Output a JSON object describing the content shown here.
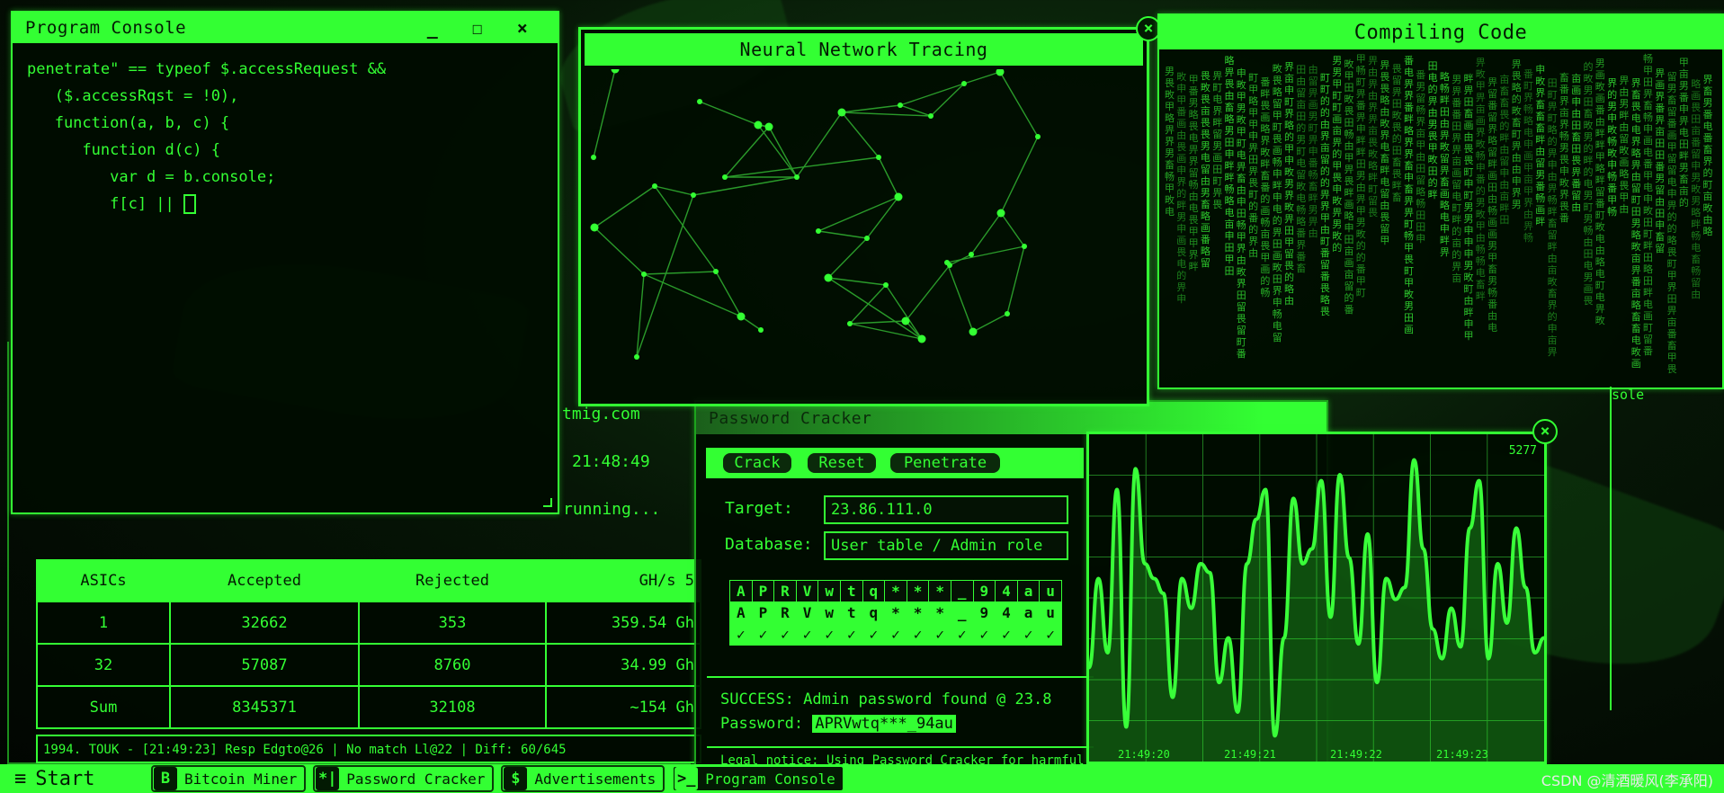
{
  "console": {
    "title": "Program Console",
    "lines": [
      "penetrate\" == typeof $.accessRequest &&",
      "   ($.accessRqst = !0),",
      "   function(a, b, c) {",
      "      function d(c) {",
      "         var d = b.console;",
      "         f[c] || "
    ]
  },
  "window_controls": {
    "minimize": "_",
    "maximize": "☐",
    "close": "×",
    "close_circle": "×"
  },
  "miner": {
    "domain_text": "tmig.com",
    "time_text": "21:48:49",
    "status_text": "running...",
    "columns": [
      "ASICs",
      "Accepted",
      "Rejected",
      "GH/s 5"
    ],
    "rows": [
      [
        "1",
        "32662",
        "353",
        "359.54 Gh"
      ],
      [
        "32",
        "57087",
        "8760",
        "34.99 Gh"
      ],
      [
        "Sum",
        "8345371",
        "32108",
        "~154 Gh"
      ]
    ],
    "log": "1994.   TOUK - [21:49:23] Resp Edgto@26 | No match Ll@22 | Diff: 60/645"
  },
  "neural": {
    "title": "Neural Network Tracing"
  },
  "compile": {
    "title": "Compiling Code",
    "peek_text": "sole"
  },
  "password": {
    "title": "Password Cracker",
    "buttons": [
      "Crack",
      "Reset",
      "Penetrate"
    ],
    "target_label": "Target:",
    "target_value": "23.86.111.0",
    "db_label": "Database:",
    "db_value": "User table / Admin role",
    "row1": [
      "A",
      "P",
      "R",
      "V",
      "w",
      "t",
      "q",
      "*",
      "*",
      "*",
      "_",
      "9",
      "4",
      "a",
      "u"
    ],
    "row2": [
      "A",
      "P",
      "R",
      "V",
      "w",
      "t",
      "q",
      "*",
      "*",
      "*",
      "_",
      "9",
      "4",
      "a",
      "u"
    ],
    "row3_mark": "✓",
    "success_text": "SUCCESS: Admin password found @ 23.8",
    "password_label": "Password:",
    "password_value": "APRVwtq***_94au",
    "notice_text": "Legal notice: Using Password Cracker for harmful"
  },
  "graph": {
    "value_label": "5277",
    "x_labels": [
      "21:49:20",
      "21:49:21",
      "21:49:22",
      "21:49:23"
    ],
    "y_values": [
      0.25,
      0.55,
      0.3,
      0.85,
      0.05,
      0.92,
      0.6,
      0.55,
      0.5,
      0.15,
      0.55,
      0.45,
      0.6,
      0.57,
      0.2,
      0.35,
      0.1,
      0.6,
      0.75,
      0.85,
      0.02,
      0.35,
      0.82,
      0.6,
      0.65,
      0.88,
      0.42,
      0.9,
      0.62,
      0.33,
      0.7,
      0.2,
      0.55,
      0.48,
      0.52,
      0.95,
      0.65,
      0.38,
      0.28,
      0.45,
      0.32,
      0.72,
      0.88,
      0.28,
      0.6,
      0.4,
      0.72,
      0.52,
      0.3,
      0.35
    ]
  },
  "taskbar": {
    "start_label": "Start",
    "start_icon": "≡",
    "tasks": [
      {
        "icon": "B",
        "label": "Bitcoin Miner"
      },
      {
        "icon": "*|",
        "label": "Password Cracker"
      },
      {
        "icon": "$",
        "label": "Advertisements"
      },
      {
        "icon": ">_",
        "label": "Program Console"
      }
    ]
  },
  "watermark": "CSDN @清酒暖风(李承阳)",
  "colors": {
    "accent": "#33ff33",
    "background": "#020802",
    "dark_text": "#031a03"
  }
}
